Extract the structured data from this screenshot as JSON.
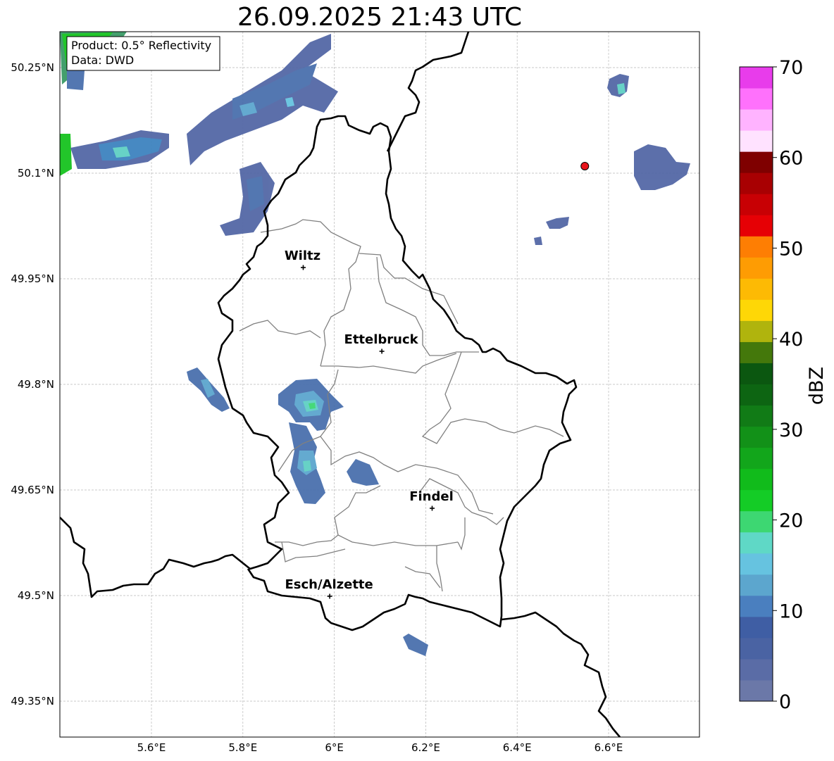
{
  "title": "26.09.2025 21:43 UTC",
  "info_box": {
    "line1": "Product: 0.5° Reflectivity",
    "line2": "Data: DWD"
  },
  "map": {
    "extent_lon": [
      5.4,
      6.8
    ],
    "extent_lat": [
      49.3,
      50.3
    ],
    "lat_ticks": [
      {
        "value": 50.25,
        "label": "50.25°N"
      },
      {
        "value": 50.1,
        "label": "50.1°N"
      },
      {
        "value": 49.95,
        "label": "49.95°N"
      },
      {
        "value": 49.8,
        "label": "49.8°N"
      },
      {
        "value": 49.65,
        "label": "49.65°N"
      },
      {
        "value": 49.5,
        "label": "49.5°N"
      },
      {
        "value": 49.35,
        "label": "49.35°N"
      }
    ],
    "lon_ticks": [
      {
        "value": 5.6,
        "label": "5.6°E"
      },
      {
        "value": 5.8,
        "label": "5.8°E"
      },
      {
        "value": 6.0,
        "label": "6°E"
      },
      {
        "value": 6.2,
        "label": "6.2°E"
      },
      {
        "value": 6.4,
        "label": "6.4°E"
      },
      {
        "value": 6.6,
        "label": "6.6°E"
      }
    ],
    "grid": true,
    "cities": [
      {
        "name": "Wiltz",
        "lon": 5.932,
        "lat": 49.966
      },
      {
        "name": "Ettelbruck",
        "lon": 6.104,
        "lat": 49.847
      },
      {
        "name": "Findel",
        "lon": 6.214,
        "lat": 49.624
      },
      {
        "name": "Esch/Alzette",
        "lon": 5.99,
        "lat": 49.499
      }
    ],
    "radar_site": {
      "lon": 6.548,
      "lat": 50.11,
      "color": "#e8141b"
    }
  },
  "colorbar": {
    "label": "dBZ",
    "ticks": [
      0,
      10,
      20,
      30,
      40,
      50,
      60,
      70
    ],
    "colors": [
      "#6b78a8",
      "#5a6ca6",
      "#4a63a3",
      "#3f5ea4",
      "#4a7fbf",
      "#5ca6ce",
      "#66c3e0",
      "#5fd8c6",
      "#3dd772",
      "#14cc26",
      "#11bb1b",
      "#12a61b",
      "#129118",
      "#117b16",
      "#0d6512",
      "#0b5710",
      "#44780b",
      "#b0b40d",
      "#fed706",
      "#fdba04",
      "#fe9c03",
      "#fe7e03",
      "#e60005",
      "#c80004",
      "#a80002",
      "#7f0000",
      "#ffe2ff",
      "#ffb3ff",
      "#ff71fc",
      "#e83ceb"
    ]
  }
}
